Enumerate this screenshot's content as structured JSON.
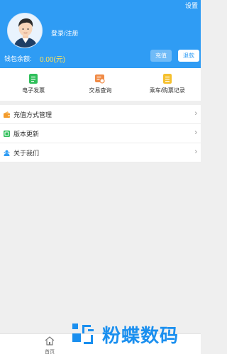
{
  "header": {
    "settings_label": "设置",
    "login_label": "登录/注册",
    "wallet_label": "钱包余额:",
    "wallet_value": "0.00(元)",
    "recharge_label": "充值",
    "refund_label": "退款",
    "background_color": "#2f9cf4",
    "balance_color": "#ffe25a"
  },
  "quick_actions": [
    {
      "label": "电子发票",
      "icon": "invoice-icon",
      "color": "#2fbf5a"
    },
    {
      "label": "交易查询",
      "icon": "transaction-icon",
      "color": "#f08a45"
    },
    {
      "label": "乘车/购票记录",
      "icon": "ticket-record-icon",
      "color": "#f5c02e"
    }
  ],
  "menu": [
    {
      "label": "充值方式管理",
      "icon": "wallet-icon",
      "color": "#f39b2c"
    },
    {
      "label": "版本更新",
      "icon": "update-icon",
      "color": "#2fbf5a"
    },
    {
      "label": "关于我们",
      "icon": "team-icon",
      "color": "#2f9cf4"
    }
  ],
  "tabbar": {
    "home_label": "首页",
    "home_icon": "home-icon"
  },
  "watermark": {
    "text": "粉蝶数码"
  }
}
